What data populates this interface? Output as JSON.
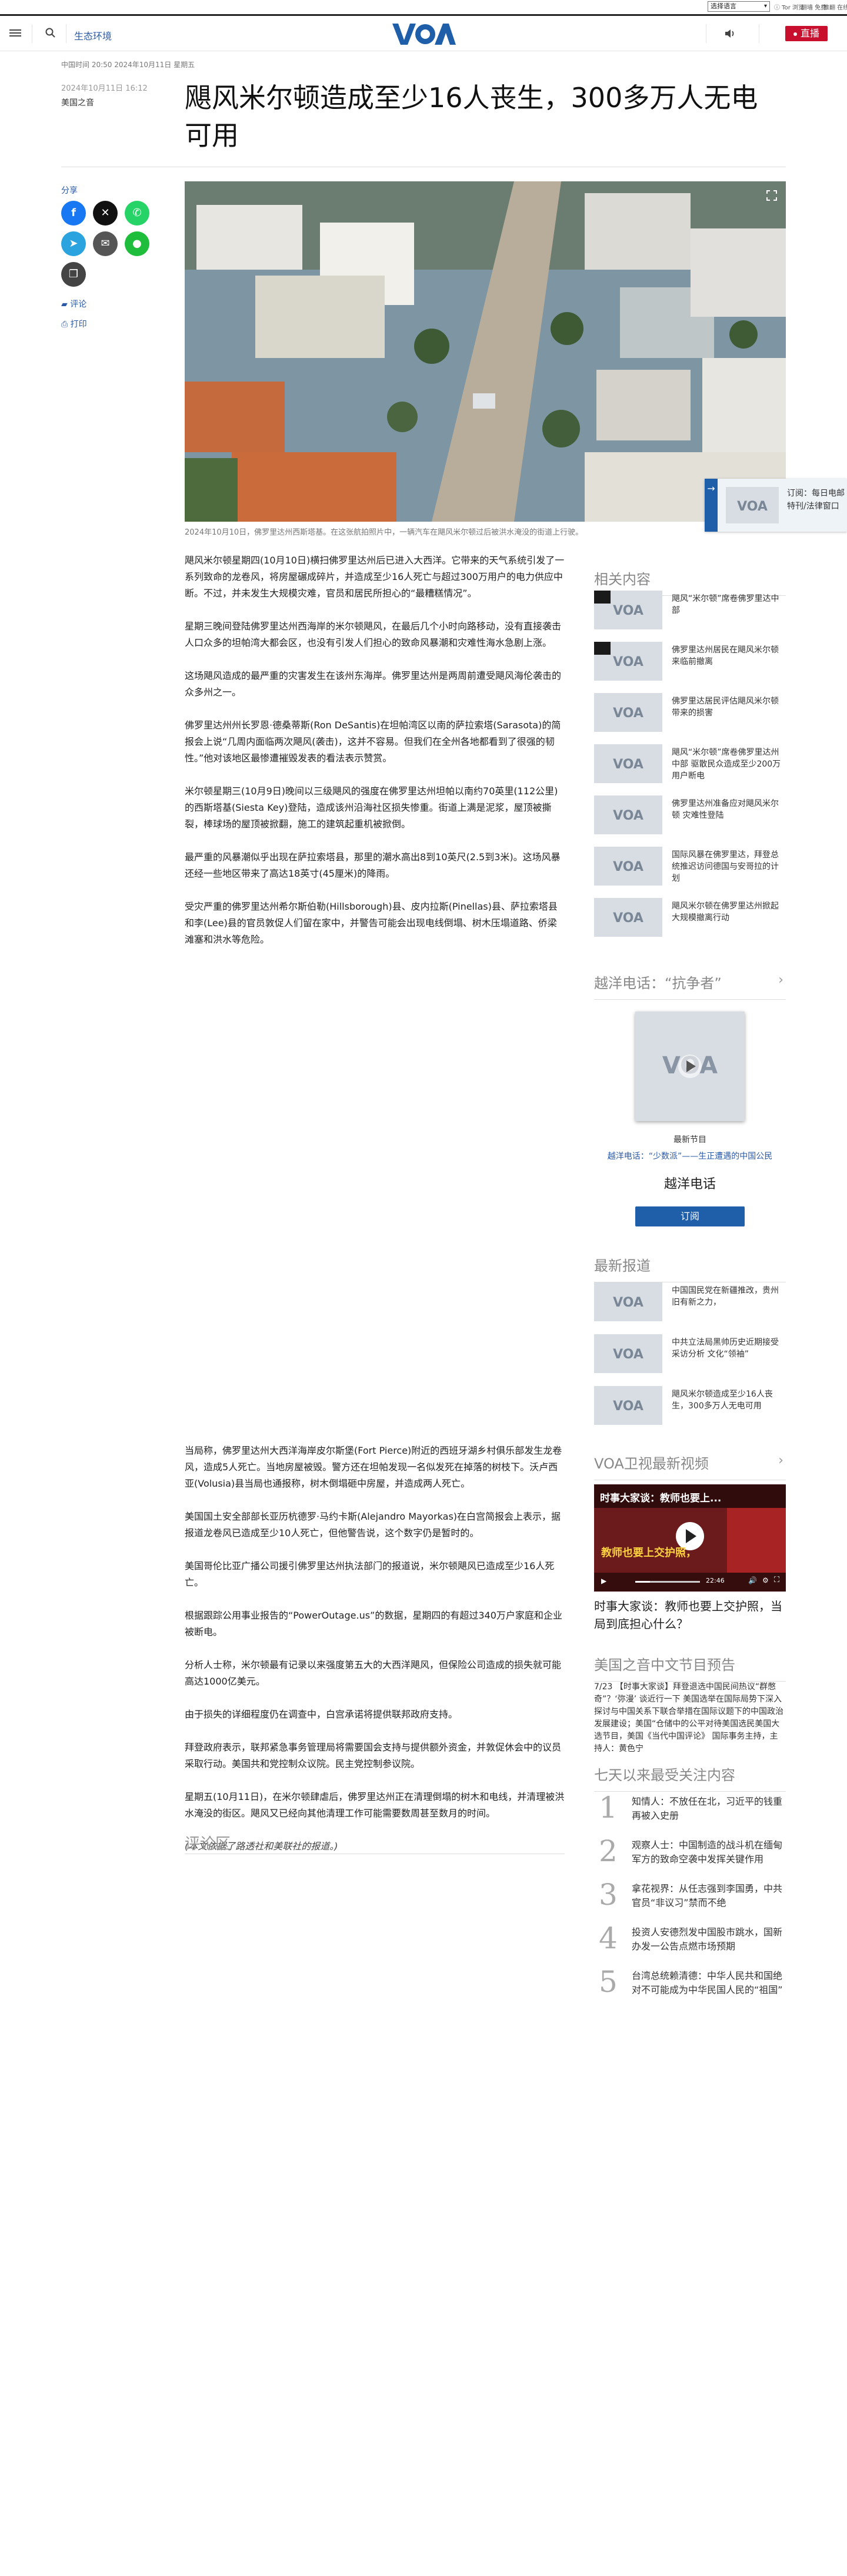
{
  "util": {
    "language_select": "选择语言",
    "links": [
      "ⓘ Tor 浏览",
      "翻墙 免费",
      "推翻 在线"
    ]
  },
  "header": {
    "section": "生态环境",
    "live": "直播"
  },
  "timestamp": "中国时间 20:50 2024年10月11日 星期五",
  "article": {
    "date": "2024年10月11日 16:12",
    "category": "美国之音",
    "headline": "飓风米尔顿造成至少16人丧生，300多万人无电可用",
    "caption": "2024年10月10日，佛罗里达州西斯塔基。在这张航拍照片中，一辆汽车在飓风米尔顿过后被洪水淹没的街道上行驶。",
    "share": {
      "label": "分享",
      "comment": "评论",
      "print": "打印"
    },
    "paragraphs_top": [
      "飓风米尔顿星期四(10月10日)横扫佛罗里达州后已进入大西洋。它带来的天气系统引发了一系列致命的龙卷风，将房屋碾成碎片，并造成至少16人死亡与超过300万用户的电力供应中断。不过，并未发生大规模灾难，官员和居民所担心的“最糟糕情况”。",
      "星期三晚间登陆佛罗里达州西海岸的米尔顿飓风，在最后几个小时向路移动，没有直接袭击人口众多的坦帕湾大都会区，也没有引发人们担心的致命风暴潮和灾难性海水急剧上涨。",
      "这场飓风造成的最严重的灾害发生在该州东海岸。佛罗里达州是两周前遭受飓风海伦袭击的众多州之一。",
      "佛罗里达州州长罗恩·德桑蒂斯(Ron DeSantis)在坦帕湾区以南的萨拉索塔(Sarasota)的简报会上说“几周内面临两次飓风(袭击)，这并不容易。但我们在全州各地都看到了很强的韧性。”他对该地区最惨遭摧毁发表的看法表示赞赏。",
      "米尔顿星期三(10月9日)晚间以三级飓风的强度在佛罗里达州坦帕以南约70英里(112公里)的西斯塔基(Siesta Key)登陆，造成该州沿海社区损失惨重。街道上满是泥浆，屋顶被撕裂，棒球场的屋顶被掀翻，施工的建筑起重机被掀倒。",
      "最严重的风暴潮似乎出现在萨拉索塔县，那里的潮水高出8到10英尺(2.5到3米)。这场风暴还经一些地区带来了高达18英寸(45厘米)的降雨。",
      "受灾严重的佛罗里达州希尔斯伯勒(Hillsborough)县、皮内拉斯(Pinellas)县、萨拉索塔县和李(Lee)县的官员敦促人们留在家中，并警告可能会出现电线倒塌、树木压塌道路、侨梁滩塞和洪水等危险。"
    ],
    "paragraphs_bottom": [
      "当局称，佛罗里达州大西洋海岸皮尔斯堡(Fort Pierce)附近的西班牙湖乡村俱乐部发生龙卷风，造成5人死亡。当地房屋被毁。警方还在坦帕发现一名似发死在掉落的树枝下。沃卢西亚(Volusia)县当局也通报称，树木倒塌砸中房屋，并造成两人死亡。",
      "美国国土安全部部长亚历杭德罗·马约卡斯(Alejandro Mayorkas)在白宫简报会上表示，据报道龙卷风已造成至少10人死亡，但他警告说，这个数字仍是暂时的。",
      "美国哥伦比亚广播公司援引佛罗里达州执法部门的报道说，米尔顿飓风已造成至少16人死亡。",
      "根据跟踪公用事业报告的“PowerOutage.us”的数据，星期四的有超过340万户家庭和企业被断电。",
      "分析人士称，米尔顿最有记录以来强度第五大的大西洋飓风，但保险公司造成的损失就可能高达1000亿美元。",
      "由于损失的详细程度仍在调查中，白宫承诺将提供联邦政府支持。",
      "拜登政府表示，联邦紧急事务管理局将需要国会支持与提供额外资金，并敦促休会中的议员采取行动。美国共和党控制众议院。民主党控制参议院。",
      "星期五(10月11日)，在米尔顿肆虐后，佛罗里达州正在清理倒塌的树木和电线，并清理被洪水淹没的街区。飓风又已经向其他清理工作可能需要数周甚至数月的时间。"
    ],
    "note": "(本文依据了路透社和美联社的报道。)",
    "comments_heading": "评论区"
  },
  "popup": {
    "text": "订阅：每日电邮特刊/法律窗口"
  },
  "sidebar": {
    "related_heading": "相关内容",
    "related": [
      {
        "text": "飓风“米尔顿”席卷佛罗里达中部"
      },
      {
        "text": "佛罗里达州居民在飓风米尔顿来临前撤离"
      },
      {
        "text": "佛罗里达居民评估飓风米尔顿带来的损害"
      },
      {
        "text": "飓风“米尔顿”席卷佛罗里达州中部 驱散民众造成至少200万用户断电"
      },
      {
        "text": "佛罗里达州准备应对飓风米尔顿 灾难性登陆"
      },
      {
        "text": "国际风暴在佛罗里达，拜登总统推迟访问德国与安哥拉的计划"
      },
      {
        "text": "飓风米尔顿在佛罗里达州掀起大规模撤离行动"
      }
    ],
    "podcast_heading": "越洋电话：“抗争者”",
    "podcast": {
      "latest": "最新节目",
      "episode": "越洋电话：“少数派”——生正遭遇的中国公民",
      "name": "越洋电话",
      "subscribe": "订阅"
    },
    "latest_heading": "最新报道",
    "latest": [
      {
        "text": "中国国民党在新疆推改，贵州旧有新之力，"
      },
      {
        "text": "中共立法局黑帅历史近期接受采访分析 文化“领袖”"
      },
      {
        "text": "飓风米尔顿造成至少16人丧生，300多万人无电可用"
      }
    ],
    "video_heading": "VOA卫视最新视频",
    "video": {
      "overlay_title": "时事大家谈：教师也要上...",
      "caption_red": "教师也要上交护照，",
      "time": "22:46",
      "title": "时事大家谈：教师也要上交护照，当局到底担心什么？"
    },
    "program_heading": "美国之音中文节目预告",
    "program_text": "7/23 【时事大家谈】拜登退选中国民间热议“群憋奇”？‘弥漫’ 谈近行一下 美国选举在国际局势下深入探讨与中国关系下联合举措在国际议题下的中国政治发展建设；美国“仓储中的公平对待美国选民美国大选节目，美国《当代中国评论》 国际事务主持，主持人：黄色宁",
    "popular_heading": "七天以来最受关注内容",
    "popular": [
      {
        "num": "1",
        "text": "知情人：不放任在北，习近平的钱重再被入史册"
      },
      {
        "num": "2",
        "text": "观察人士：中国制造的战斗机在缅甸军方的致命空袭中发挥关键作用"
      },
      {
        "num": "3",
        "text": "拿花视界：从任志强到李国勇，中共官员“非议习”禁而不绝"
      },
      {
        "num": "4",
        "text": "投资人安德烈发中国股市跳水，国新办发一公告点燃市场预期"
      },
      {
        "num": "5",
        "text": "台湾总统赖清德：中华人民共和国绝对不可能成为中华民国人民的“祖国”"
      }
    ]
  },
  "colors": {
    "accent_blue": "#1f5ea8",
    "live_red": "#c8102e",
    "link_blue": "#2b5aa6"
  }
}
